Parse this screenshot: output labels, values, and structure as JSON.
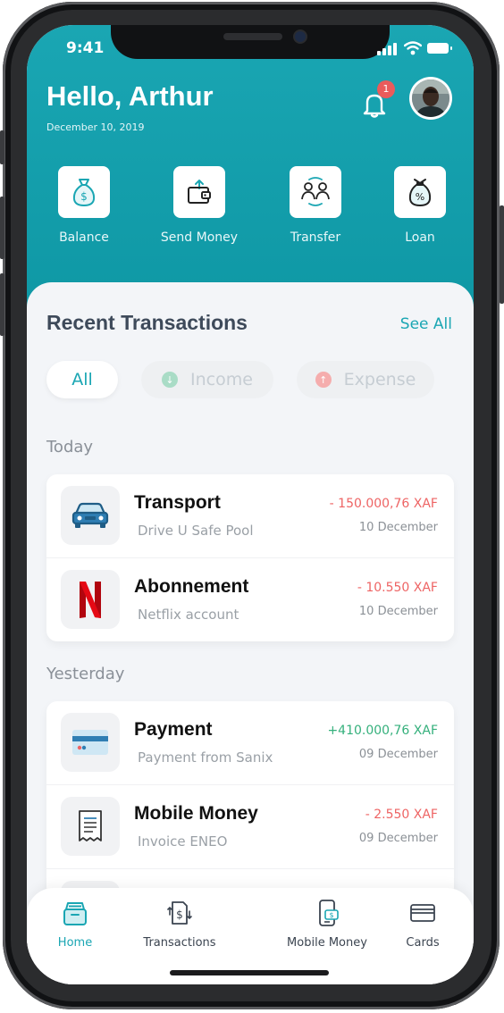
{
  "status": {
    "time": "9:41"
  },
  "header": {
    "greeting": "Hello, Arthur",
    "date": "December 10, 2019",
    "notification_count": "1"
  },
  "actions": [
    {
      "label": "Balance",
      "icon": "money-bag-icon"
    },
    {
      "label": "Send Money",
      "icon": "wallet-send-icon"
    },
    {
      "label": "Transfer",
      "icon": "transfer-users-icon"
    },
    {
      "label": "Loan",
      "icon": "loan-bag-icon"
    }
  ],
  "recent": {
    "title": "Recent Transactions",
    "see_all": "See All",
    "filters": {
      "all": "All",
      "income": "Income",
      "expense": "Expense"
    }
  },
  "groups": [
    {
      "label": "Today",
      "items": [
        {
          "title": "Transport",
          "subtitle": "Drive U Safe Pool",
          "amount": "- 150.000,76 XAF",
          "date": "10 December",
          "type": "expense",
          "icon": "car-icon"
        },
        {
          "title": "Abonnement",
          "subtitle": "Netflix account",
          "amount": "- 10.550 XAF",
          "date": "10 December",
          "type": "expense",
          "icon": "netflix-icon"
        }
      ]
    },
    {
      "label": "Yesterday",
      "items": [
        {
          "title": "Payment",
          "subtitle": "Payment from Sanix",
          "amount": "+410.000,76 XAF",
          "date": "09 December",
          "type": "income",
          "icon": "credit-card-icon"
        },
        {
          "title": "Mobile Money",
          "subtitle": "Invoice ENEO",
          "amount": "- 2.550 XAF",
          "date": "09 December",
          "type": "expense",
          "icon": "receipt-icon"
        }
      ]
    }
  ],
  "tabs": [
    {
      "label": "Home",
      "icon": "home-icon",
      "active": true
    },
    {
      "label": "Transactions",
      "icon": "transactions-icon",
      "active": false
    },
    {
      "label": "Mobile Money",
      "icon": "mobile-money-icon",
      "active": false
    },
    {
      "label": "Cards",
      "icon": "cards-icon",
      "active": false
    }
  ],
  "colors": {
    "primary": "#1aa6b3",
    "expense": "#ee6464",
    "income": "#35b07c",
    "badge": "#ea5b5b"
  }
}
